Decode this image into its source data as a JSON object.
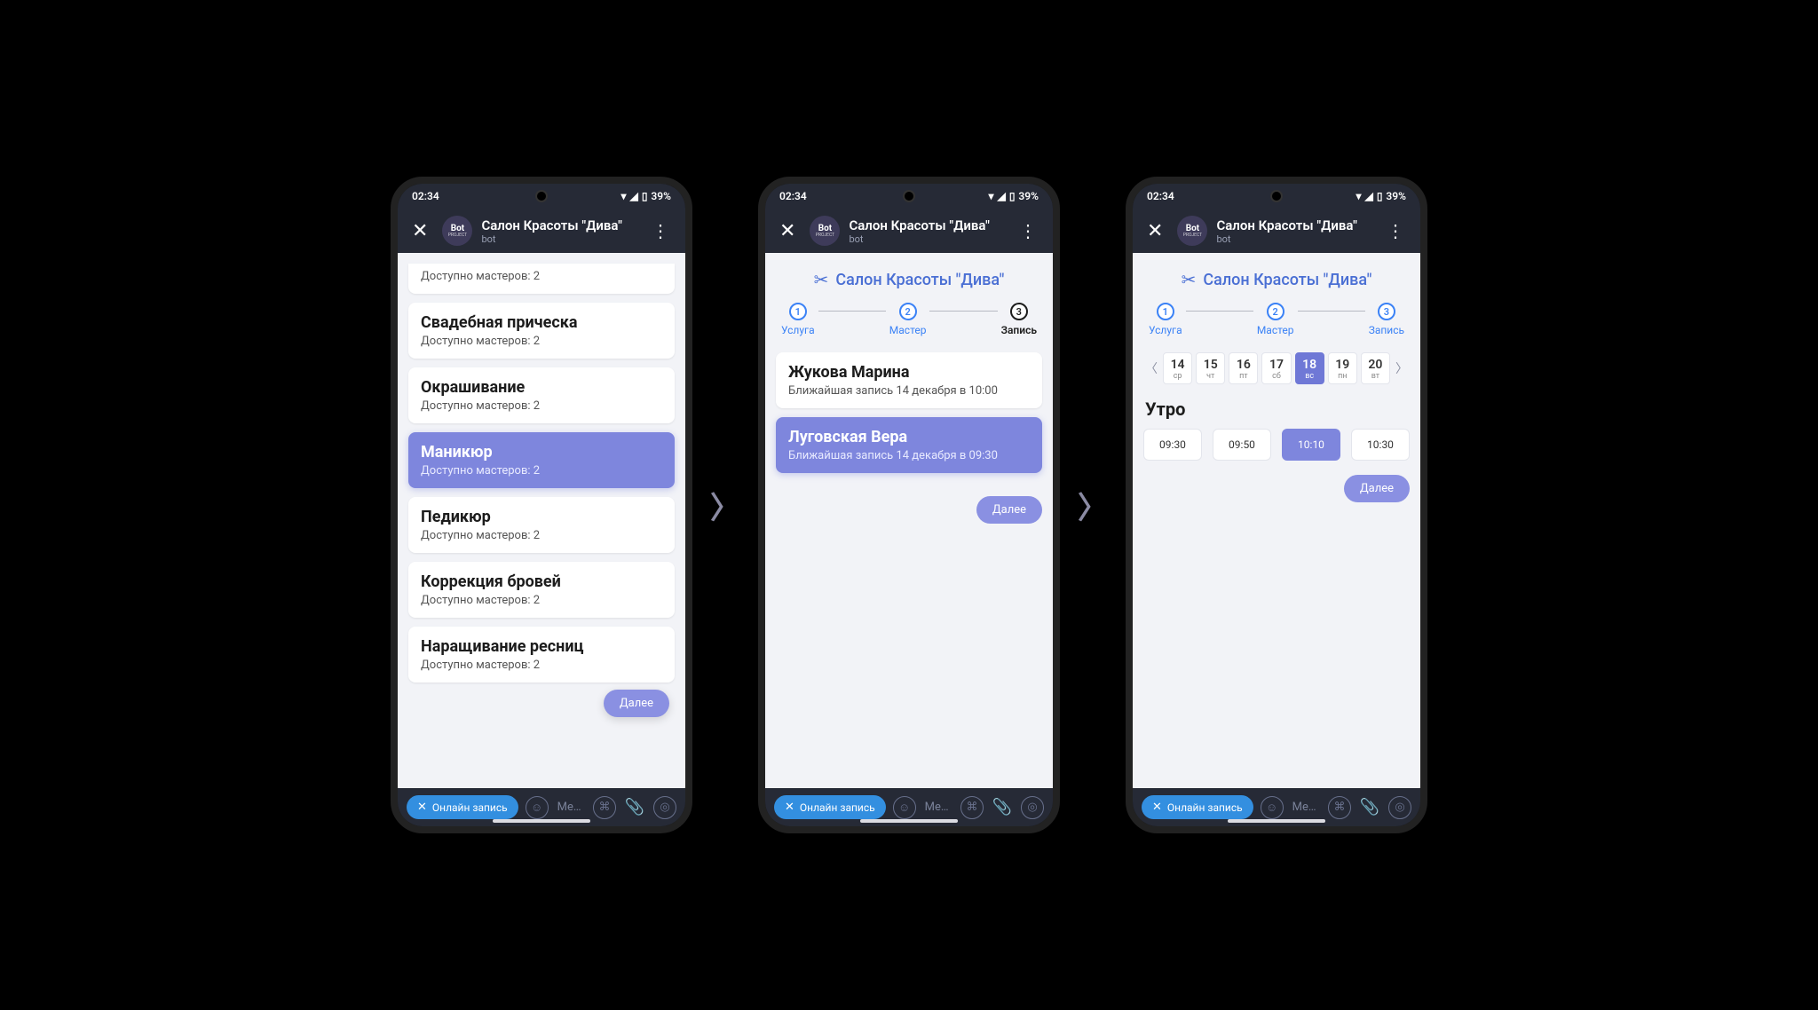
{
  "status": {
    "time": "02:34",
    "battery": "39%"
  },
  "header": {
    "title": "Салон Красоты \"Дива\"",
    "subtitle": "bot",
    "avatar_top": "Bot",
    "avatar_bottom": "PROJECT"
  },
  "salon_name": "Салон Красоты \"Дива\"",
  "stepper": {
    "s1": {
      "num": "1",
      "label": "Услуга"
    },
    "s2": {
      "num": "2",
      "label": "Мастер"
    },
    "s3": {
      "num": "3",
      "label": "Запись"
    }
  },
  "buttons": {
    "next": "Далее"
  },
  "bottom": {
    "chip": "Онлайн запись",
    "placeholder": "Mess…"
  },
  "screen1": {
    "partial_sub": "Доступно мастеров: 2",
    "cards": [
      {
        "title": "Свадебная прическа",
        "sub": "Доступно мастеров: 2",
        "selected": false
      },
      {
        "title": "Окрашивание",
        "sub": "Доступно мастеров: 2",
        "selected": false
      },
      {
        "title": "Маникюр",
        "sub": "Доступно мастеров: 2",
        "selected": true
      },
      {
        "title": "Педикюр",
        "sub": "Доступно мастеров: 2",
        "selected": false
      },
      {
        "title": "Коррекция бровей",
        "sub": "Доступно мастеров: 2",
        "selected": false
      },
      {
        "title": "Наращивание ресниц",
        "sub": "Доступно мастеров: 2",
        "selected": false
      }
    ]
  },
  "screen2": {
    "cards": [
      {
        "title": "Жукова Марина",
        "sub": "Ближайшая запись 14 декабря в 10:00",
        "selected": false
      },
      {
        "title": "Луговская Вера",
        "sub": "Ближайшая запись 14 декабря в 09:30",
        "selected": true
      }
    ]
  },
  "screen3": {
    "dates": [
      {
        "num": "14",
        "day": "ср",
        "selected": false
      },
      {
        "num": "15",
        "day": "чт",
        "selected": false
      },
      {
        "num": "16",
        "day": "пт",
        "selected": false
      },
      {
        "num": "17",
        "day": "сб",
        "selected": false
      },
      {
        "num": "18",
        "day": "вс",
        "selected": true
      },
      {
        "num": "19",
        "day": "пн",
        "selected": false
      },
      {
        "num": "20",
        "day": "вт",
        "selected": false
      }
    ],
    "section": "Утро",
    "times": [
      {
        "t": "09:30",
        "selected": false
      },
      {
        "t": "09:50",
        "selected": false
      },
      {
        "t": "10:10",
        "selected": true
      },
      {
        "t": "10:30",
        "selected": false
      }
    ]
  }
}
